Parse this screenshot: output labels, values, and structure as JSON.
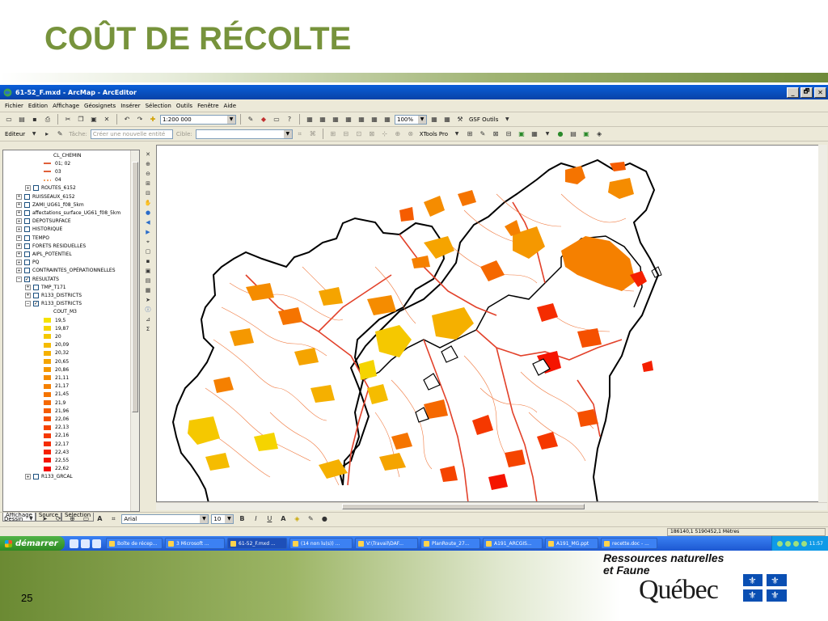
{
  "slide": {
    "title": "COÛT DE RÉCOLTE",
    "page_number": "25",
    "brand_line1": "Ressources naturelles",
    "brand_line2": "et Faune",
    "brand_name": "Québec",
    "title_color": "#77933c"
  },
  "window": {
    "title": "61-52_F.mxd - ArcMap - ArcEditor",
    "controls": [
      "_",
      "🗗",
      "✕"
    ]
  },
  "menu": [
    "Fichier",
    "Edition",
    "Affichage",
    "Géosignets",
    "Insérer",
    "Sélection",
    "Outils",
    "Fenêtre",
    "Aide"
  ],
  "toolbar": {
    "scale": "1:200 000",
    "zoom": "100%",
    "gsf_label": "GSF Outils",
    "editor_label": "Editeur",
    "task_label": "Tâche:",
    "task_value": "Créer une nouvelle entité",
    "target_label": "Cible:",
    "xtools_label": "XTools Pro"
  },
  "toc": {
    "chemin_layer": "CL_CHEMIN",
    "chemin_classes": [
      {
        "label": "01; 02",
        "color": "#e0603a",
        "style": "solid"
      },
      {
        "label": "03",
        "color": "#e0603a",
        "style": "solid"
      },
      {
        "label": "04",
        "color": "#f0a060",
        "style": "dashed"
      }
    ],
    "layers": [
      {
        "label": "ROUTES_6152",
        "indent": 2,
        "checked": false
      },
      {
        "label": "RUISSEAUX_6152",
        "indent": 1,
        "checked": false
      },
      {
        "label": "ZAMI_UG61_f08_5km",
        "indent": 1,
        "checked": false
      },
      {
        "label": "affectations_surface_UG61_f08_5km",
        "indent": 1,
        "checked": false
      },
      {
        "label": "DEPOTSURFACE",
        "indent": 1,
        "checked": false
      },
      {
        "label": "HISTORIQUE",
        "indent": 1,
        "checked": false
      },
      {
        "label": "TEMPO",
        "indent": 1,
        "checked": false
      },
      {
        "label": "FORETS RESIDUELLES",
        "indent": 1,
        "checked": false
      },
      {
        "label": "AIPL_POTENTIEL",
        "indent": 1,
        "checked": false
      },
      {
        "label": "PQ",
        "indent": 1,
        "checked": false
      },
      {
        "label": "CONTRAINTES_OPÉRATIONNELLES",
        "indent": 1,
        "checked": false
      },
      {
        "label": "RESULTATS",
        "indent": 1,
        "checked": true,
        "expanded": true
      },
      {
        "label": "TMP_T171",
        "indent": 2,
        "checked": false
      },
      {
        "label": "R133_DISTRICTS",
        "indent": 2,
        "checked": false
      },
      {
        "label": "R133_DISTRICTS",
        "indent": 2,
        "checked": true,
        "expanded": true
      }
    ],
    "cout_field": "COUT_M3",
    "cout_classes": [
      {
        "label": "19,5",
        "color": "#f5e200"
      },
      {
        "label": "19,87",
        "color": "#f5d400"
      },
      {
        "label": "20",
        "color": "#f5c800"
      },
      {
        "label": "20,09",
        "color": "#f5bc00"
      },
      {
        "label": "20,32",
        "color": "#f5b000"
      },
      {
        "label": "20,65",
        "color": "#f5a400"
      },
      {
        "label": "20,86",
        "color": "#f59800"
      },
      {
        "label": "21,11",
        "color": "#f58c00"
      },
      {
        "label": "21,17",
        "color": "#f58000"
      },
      {
        "label": "21,45",
        "color": "#f57400"
      },
      {
        "label": "21,9",
        "color": "#f56800"
      },
      {
        "label": "21,96",
        "color": "#f55c00"
      },
      {
        "label": "22,06",
        "color": "#f55000"
      },
      {
        "label": "22,13",
        "color": "#f54400"
      },
      {
        "label": "22,16",
        "color": "#f53800"
      },
      {
        "label": "22,17",
        "color": "#f52c00"
      },
      {
        "label": "22,43",
        "color": "#f52000"
      },
      {
        "label": "22,55",
        "color": "#f51400"
      },
      {
        "label": "22,62",
        "color": "#f50800"
      }
    ],
    "last_layer": "R133_GRCAL",
    "tabs": [
      "Affichage",
      "Source",
      "Sélection"
    ]
  },
  "drawbar": {
    "dessin_label": "Dessin",
    "font": "Arial",
    "font_size": "10",
    "bold": "B",
    "italic": "I",
    "underline": "U"
  },
  "status": {
    "coords": "186140,1  5190452,1 Mètres"
  },
  "taskbar": {
    "start_label": "démarrer",
    "tasks": [
      "Boîte de récep...",
      "3 Microsoft ...",
      "61-52_F.mxd ...",
      "(14 non lu(s)) ...",
      "V:\\Travail\\DAF...",
      "PlanRoute_27...",
      "A191_ARCGIS...",
      "A191_MG.ppt",
      "recette.doc - ..."
    ],
    "clock": "11:57"
  }
}
